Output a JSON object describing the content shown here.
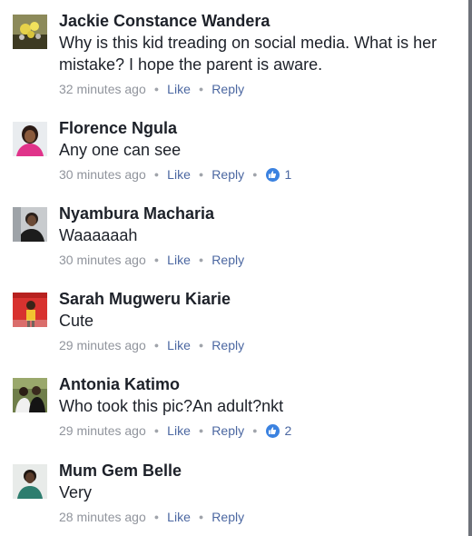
{
  "comments": [
    {
      "author": "Jackie Constance Wandera",
      "text": "Why is this kid treading on social media. What is her mistake? I hope the parent is aware.",
      "time": "32 minutes ago",
      "like_label": "Like",
      "reply_label": "Reply",
      "reactions": null
    },
    {
      "author": "Florence Ngula",
      "text": "Any one can see",
      "time": "30 minutes ago",
      "like_label": "Like",
      "reply_label": "Reply",
      "reactions": "1"
    },
    {
      "author": "Nyambura Macharia",
      "text": "Waaaaaah",
      "time": "30 minutes ago",
      "like_label": "Like",
      "reply_label": "Reply",
      "reactions": null
    },
    {
      "author": "Sarah Mugweru Kiarie",
      "text": "Cute",
      "time": "29 minutes ago",
      "like_label": "Like",
      "reply_label": "Reply",
      "reactions": null
    },
    {
      "author": "Antonia Katimo",
      "text": "Who took this pic?An adult?nkt",
      "time": "29 minutes ago",
      "like_label": "Like",
      "reply_label": "Reply",
      "reactions": "2"
    },
    {
      "author": "Mum Gem Belle",
      "text": "Very",
      "time": "28 minutes ago",
      "like_label": "Like",
      "reply_label": "Reply",
      "reactions": null
    }
  ],
  "icons": {
    "reaction": "thumbs-up-icon",
    "separator": "dot"
  },
  "colors": {
    "author": "#1d2129",
    "meta": "#90949c",
    "action_link": "#4b67a1",
    "reaction_badge": "#3b82e0"
  }
}
